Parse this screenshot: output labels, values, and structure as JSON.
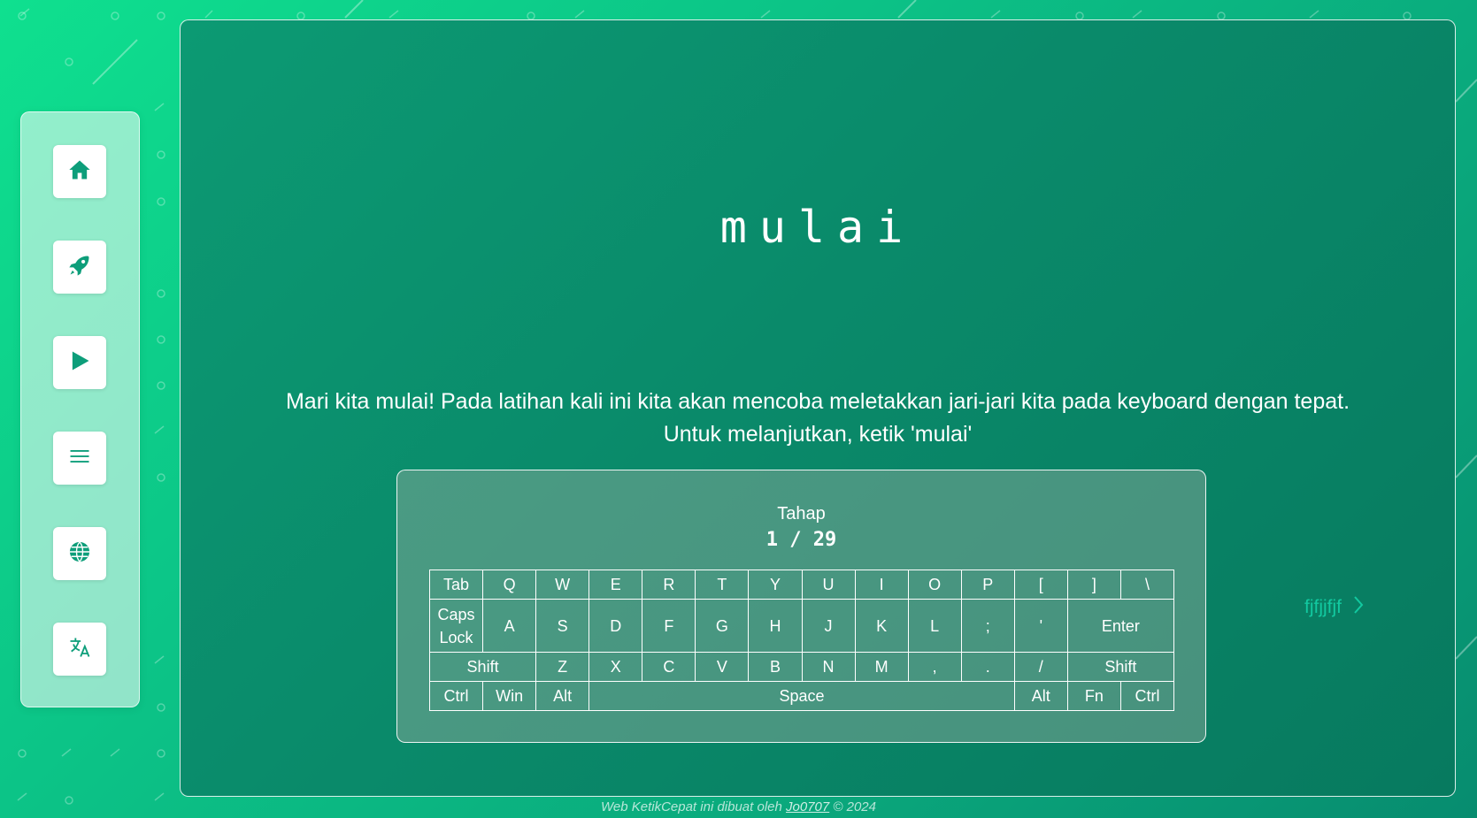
{
  "sidebar": {
    "items": [
      {
        "icon": "home-icon"
      },
      {
        "icon": "rocket-icon"
      },
      {
        "icon": "play-icon"
      },
      {
        "icon": "menu-icon"
      },
      {
        "icon": "globe-icon"
      },
      {
        "icon": "translate-icon"
      }
    ]
  },
  "main": {
    "current_word": "mulai",
    "instruction_line1": "Mari kita mulai! Pada latihan kali ini kita akan mencoba meletakkan jari-jari kita pada keyboard dengan tepat.",
    "instruction_line2": "Untuk melanjutkan, ketik 'mulai'"
  },
  "stage": {
    "label": "Tahap",
    "count": "1 / 29"
  },
  "keyboard": {
    "row1": [
      "Tab",
      "Q",
      "W",
      "E",
      "R",
      "T",
      "Y",
      "U",
      "I",
      "O",
      "P",
      "[",
      "]",
      "\\"
    ],
    "row2": [
      "Caps\nLock",
      "A",
      "S",
      "D",
      "F",
      "G",
      "H",
      "J",
      "K",
      "L",
      ";",
      "'",
      "Enter"
    ],
    "row3": [
      "Shift",
      "Z",
      "X",
      "C",
      "V",
      "B",
      "N",
      "M",
      ",",
      ".",
      "/",
      "Shift"
    ],
    "row4": [
      "Ctrl",
      "Win",
      "Alt",
      "Space",
      "Alt",
      "Fn",
      "Ctrl"
    ]
  },
  "next": {
    "label": "fjfjjfjf"
  },
  "footer": {
    "prefix": "Web KetikCepat ini dibuat oleh ",
    "author": "Jo0707",
    "suffix": " © 2024"
  },
  "colors": {
    "accent": "#12c9a0",
    "icon": "#0d9e7a",
    "background_start": "#0fe08f",
    "background_end": "#078c6f"
  }
}
